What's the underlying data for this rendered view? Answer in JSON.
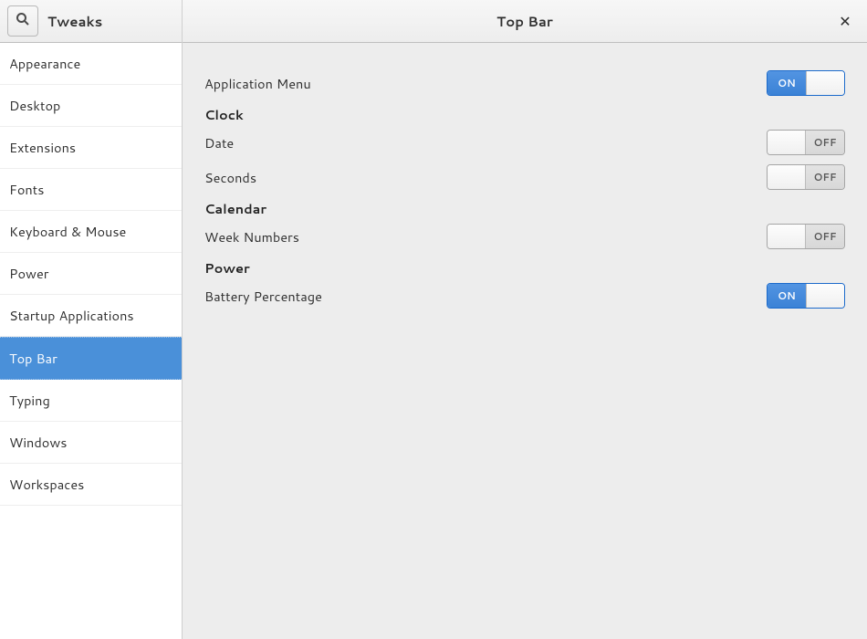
{
  "app_title": "Tweaks",
  "page_title": "Top Bar",
  "sidebar": {
    "items": [
      {
        "label": "Appearance",
        "selected": false
      },
      {
        "label": "Desktop",
        "selected": false
      },
      {
        "label": "Extensions",
        "selected": false
      },
      {
        "label": "Fonts",
        "selected": false
      },
      {
        "label": "Keyboard & Mouse",
        "selected": false
      },
      {
        "label": "Power",
        "selected": false
      },
      {
        "label": "Startup Applications",
        "selected": false
      },
      {
        "label": "Top Bar",
        "selected": true
      },
      {
        "label": "Typing",
        "selected": false
      },
      {
        "label": "Windows",
        "selected": false
      },
      {
        "label": "Workspaces",
        "selected": false
      }
    ]
  },
  "toggle_labels": {
    "on": "ON",
    "off": "OFF"
  },
  "sections": [
    {
      "heading": null,
      "rows": [
        {
          "label": "Application Menu",
          "on": true
        }
      ]
    },
    {
      "heading": "Clock",
      "rows": [
        {
          "label": "Date",
          "on": false
        },
        {
          "label": "Seconds",
          "on": false
        }
      ]
    },
    {
      "heading": "Calendar",
      "rows": [
        {
          "label": "Week Numbers",
          "on": false
        }
      ]
    },
    {
      "heading": "Power",
      "rows": [
        {
          "label": "Battery Percentage",
          "on": true
        }
      ]
    }
  ]
}
